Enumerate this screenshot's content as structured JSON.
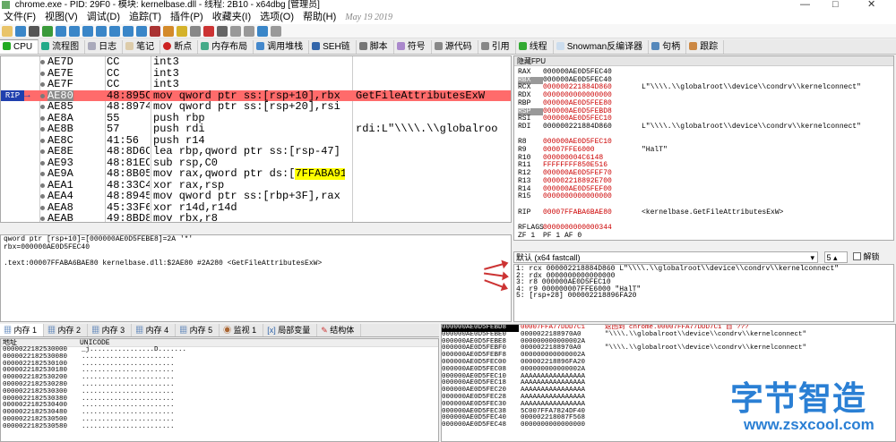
{
  "window": {
    "title": "chrome.exe - PID: 29F0 - 模块: kernelbase.dll - 线程: 2B10 - x64dbg [管理员]"
  },
  "menu": [
    "文件(F)",
    "视图(V)",
    "调试(D)",
    "追踪(T)",
    "插件(P)",
    "收藏夹(I)",
    "选项(O)",
    "帮助(H)"
  ],
  "menu_date": "May 19 2019",
  "tabs": [
    "CPU",
    "流程图",
    "日志",
    "笔记",
    "断点",
    "内存布局",
    "调用堆栈",
    "SEH链",
    "脚本",
    "符号",
    "源代码",
    "引用",
    "线程",
    "Snowman反编译器",
    "句柄",
    "跟踪"
  ],
  "disasm": [
    {
      "addr": "AE7D",
      "bytes": "CC",
      "instr": "int3",
      "cmt": ""
    },
    {
      "addr": "AE7E",
      "bytes": "CC",
      "instr": "int3",
      "cmt": ""
    },
    {
      "addr": "AE7F",
      "bytes": "CC",
      "instr": "int3",
      "cmt": ""
    },
    {
      "addr": "AE80",
      "bytes": "48:895C",
      "instr": "mov qword ptr ss:[rsp+10],rbx",
      "cmt": "GetFileAttributesExW"
    },
    {
      "addr": "AE85",
      "bytes": "48:8974",
      "instr": "mov qword ptr ss:[rsp+20],rsi",
      "cmt": ""
    },
    {
      "addr": "AE8A",
      "bytes": "55",
      "instr": "push rbp",
      "cmt": ""
    },
    {
      "addr": "AE8B",
      "bytes": "57",
      "instr": "push rdi",
      "cmt": "rdi:L\"\\\\\\\\.\\\\globalroo"
    },
    {
      "addr": "AE8C",
      "bytes": "41:56",
      "instr": "push r14",
      "cmt": ""
    },
    {
      "addr": "AE8E",
      "bytes": "48:8D6C",
      "instr": "lea rbp,qword ptr ss:[rsp-47]",
      "cmt": ""
    },
    {
      "addr": "AE93",
      "bytes": "48:81EC",
      "instr": "sub rsp,C0",
      "cmt": ""
    },
    {
      "addr": "AE9A",
      "bytes": "48:8B05",
      "instr": "mov rax,qword ptr ds:[7FFABA91A",
      "cmt": ""
    },
    {
      "addr": "AEA1",
      "bytes": "48:33C4",
      "instr": "xor rax,rsp",
      "cmt": ""
    },
    {
      "addr": "AEA4",
      "bytes": "48:8945",
      "instr": "mov qword ptr ss:[rbp+3F],rax",
      "cmt": ""
    },
    {
      "addr": "AEA8",
      "bytes": "45:33F6",
      "instr": "xor r14d,r14d",
      "cmt": ""
    },
    {
      "addr": "AEAB",
      "bytes": "49:8BD8",
      "instr": "mov rbx,r8",
      "cmt": ""
    }
  ],
  "rip_label": "RIP",
  "info": [
    "qword ptr [rsp+10]=[000000AE0D5FEBE8]=2A '*'",
    "rbx=000000AE0D5FEC40",
    "",
    ".text:00007FFABA6BAE80 kernelbase.dll:$2AE80 #2A280 <GetFileAttributesExW>"
  ],
  "fpu_header": "隐藏FPU",
  "registers": [
    {
      "n": "RAX",
      "v": "000000AE0D5FEC40",
      "c": "",
      "red": false
    },
    {
      "n": "RBX",
      "v": "000000AE0D5FEC40",
      "c": "",
      "red": false
    },
    {
      "n": "RCX",
      "v": "000000221884D860",
      "c": "L\"\\\\\\\\.\\\\globalroot\\\\device\\\\condrv\\\\kernelconnect\"",
      "red": true
    },
    {
      "n": "RDX",
      "v": "0000000000000000",
      "c": "",
      "red": true
    },
    {
      "n": "RBP",
      "v": "000000AE0D5FEE80",
      "c": "",
      "red": true
    },
    {
      "n": "RSP",
      "v": "000000AE0D5FEBD8",
      "c": "",
      "red": true
    },
    {
      "n": "RSI",
      "v": "000000AE0D5FEC10",
      "c": "",
      "red": true
    },
    {
      "n": "RDI",
      "v": "000000221884D860",
      "c": "L\"\\\\\\\\.\\\\globalroot\\\\device\\\\condrv\\\\kernelconnect\"",
      "red": false
    },
    {
      "n": "",
      "v": "",
      "c": "",
      "red": false
    },
    {
      "n": "R8",
      "v": "000000AE0D5FEC10",
      "c": "",
      "red": true
    },
    {
      "n": "R9",
      "v": "00007FFE6000",
      "c": "\"HalT\"",
      "red": true
    },
    {
      "n": "R10",
      "v": "000000004C6148",
      "c": "",
      "red": true
    },
    {
      "n": "R11",
      "v": "FFFFFFFF850E516",
      "c": "",
      "red": true
    },
    {
      "n": "R12",
      "v": "000000AE0D5FEF70",
      "c": "",
      "red": true
    },
    {
      "n": "R13",
      "v": "000002218892E700",
      "c": "",
      "red": true
    },
    {
      "n": "R14",
      "v": "000000AE0D5FEF00",
      "c": "",
      "red": true
    },
    {
      "n": "R15",
      "v": "0000000000000000",
      "c": "",
      "red": true
    },
    {
      "n": "",
      "v": "",
      "c": "",
      "red": false
    },
    {
      "n": "RIP",
      "v": "00007FFABA6BAE80",
      "c": "<kernelbase.GetFileAttributesExW>",
      "red": true
    },
    {
      "n": "",
      "v": "",
      "c": "",
      "red": false
    },
    {
      "n": "RFLAGS",
      "v": "0000000000000344",
      "c": "",
      "red": true
    },
    {
      "n": "ZF 1",
      "v": "PF 1   AF 0",
      "c": "",
      "red": false
    }
  ],
  "callconv": {
    "label": "默认 (x64 fastcall)",
    "count": "5",
    "unlock": "解锁"
  },
  "args": [
    "1: rcx 000002218884D860 L\"\\\\\\\\.\\\\globalroot\\\\device\\\\condrv\\\\kernelconnect\"",
    "2: rdx 0000000000000000",
    "3: r8 000000AE0D5FEC10",
    "4: r9 000000007FFE6000 \"HalT\"",
    "5: [rsp+28] 000002218896FA20"
  ],
  "memtabs": [
    "内存 1",
    "内存 2",
    "内存 3",
    "内存 4",
    "内存 5",
    "监视 1",
    "局部变量",
    "结构体"
  ],
  "dump_header": {
    "addr": "地址",
    "uni": "UNICODE"
  },
  "dump": [
    {
      "a": "0000022182530000",
      "t": "_j................D......."
    },
    {
      "a": "0000022182530080",
      "t": "......................."
    },
    {
      "a": "0000022182530100",
      "t": "......................."
    },
    {
      "a": "0000022182530180",
      "t": "......................."
    },
    {
      "a": "0000022182530200",
      "t": "......................."
    },
    {
      "a": "0000022182530280",
      "t": "......................."
    },
    {
      "a": "0000022182530300",
      "t": "......................."
    },
    {
      "a": "0000022182530380",
      "t": "......................."
    },
    {
      "a": "0000022182530400",
      "t": "......................."
    },
    {
      "a": "0000022182530480",
      "t": "......................."
    },
    {
      "a": "0000022182530500",
      "t": "......................."
    },
    {
      "a": "0000022182530580",
      "t": "......................."
    }
  ],
  "stack": [
    {
      "a": "000000AE0D5FEBD8",
      "v": "00007FFA77DDD7C1",
      "c": "返回到 chrome.00007FFA77DDD7C1 自 ???"
    },
    {
      "a": "000000AE0D5FEBE0",
      "v": "0000022188970A0",
      "c": "\"\\\\\\\\.\\\\globalroot\\\\device\\\\condrv\\\\kernelconnect\""
    },
    {
      "a": "000000AE0D5FEBE8",
      "v": "000000000000002A",
      "c": ""
    },
    {
      "a": "000000AE0D5FEBF0",
      "v": "0000022188970A0",
      "c": "\"\\\\\\\\.\\\\globalroot\\\\device\\\\condrv\\\\kernelconnect\""
    },
    {
      "a": "000000AE0D5FEBF8",
      "v": "000000000000002A",
      "c": ""
    },
    {
      "a": "000000AE0D5FEC00",
      "v": "000002218896FA20",
      "c": ""
    },
    {
      "a": "000000AE0D5FEC08",
      "v": "000000000000002A",
      "c": ""
    },
    {
      "a": "000000AE0D5FEC10",
      "v": "AAAAAAAAAAAAAAAA",
      "c": ""
    },
    {
      "a": "000000AE0D5FEC18",
      "v": "AAAAAAAAAAAAAAAA",
      "c": ""
    },
    {
      "a": "000000AE0D5FEC20",
      "v": "AAAAAAAAAAAAAAAA",
      "c": ""
    },
    {
      "a": "000000AE0D5FEC28",
      "v": "AAAAAAAAAAAAAAAA",
      "c": ""
    },
    {
      "a": "000000AE0D5FEC30",
      "v": "AAAAAAAAAAAAAAAA",
      "c": ""
    },
    {
      "a": "000000AE0D5FEC38",
      "v": "5C007FFA7824DF40",
      "c": ""
    },
    {
      "a": "000000AE0D5FEC40",
      "v": "000002218087F568",
      "c": ""
    },
    {
      "a": "000000AE0D5FEC48",
      "v": "0000000000000000",
      "c": ""
    }
  ],
  "watermark": {
    "cn": "字节智造",
    "url": "www.zsxcool.com"
  },
  "colors": {
    "accent": "#2a7fd4",
    "current_row": "#ff6b6b",
    "rip_badge": "#1f3fae",
    "register_changed": "#c00000",
    "stack_return": "#c00000",
    "arrow": "#c33333"
  }
}
